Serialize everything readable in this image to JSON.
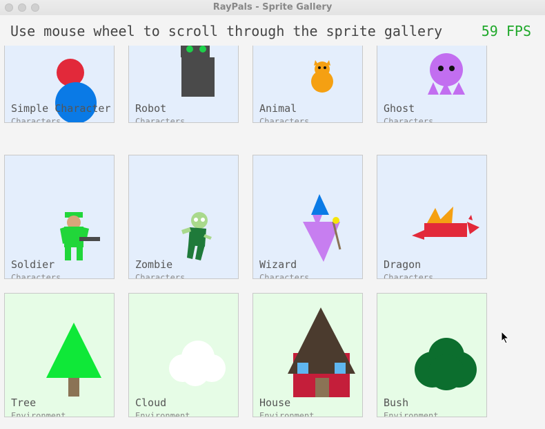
{
  "window": {
    "title": "RayPals - Sprite Gallery"
  },
  "header": {
    "instruction": "Use mouse wheel to scroll through the sprite gallery",
    "fps": "59 FPS"
  },
  "gallery": {
    "items": [
      {
        "name": "Simple Character",
        "category": "Characters"
      },
      {
        "name": "Robot",
        "category": "Characters"
      },
      {
        "name": "Animal",
        "category": "Characters"
      },
      {
        "name": "Ghost",
        "category": "Characters"
      },
      {
        "name": "Soldier",
        "category": "Characters"
      },
      {
        "name": "Zombie",
        "category": "Characters"
      },
      {
        "name": "Wizard",
        "category": "Characters"
      },
      {
        "name": "Dragon",
        "category": "Characters"
      },
      {
        "name": "Tree",
        "category": "Environment"
      },
      {
        "name": "Cloud",
        "category": "Environment"
      },
      {
        "name": "House",
        "category": "Environment"
      },
      {
        "name": "Bush",
        "category": "Environment"
      }
    ]
  },
  "colors": {
    "characters_card_bg": "#e4eefc",
    "environment_card_bg": "#e6fce6",
    "fps_text": "#1fa82a"
  },
  "icons": [
    "close-dot-icon",
    "minimize-dot-icon",
    "zoom-dot-icon",
    "mouse-pointer-icon"
  ]
}
